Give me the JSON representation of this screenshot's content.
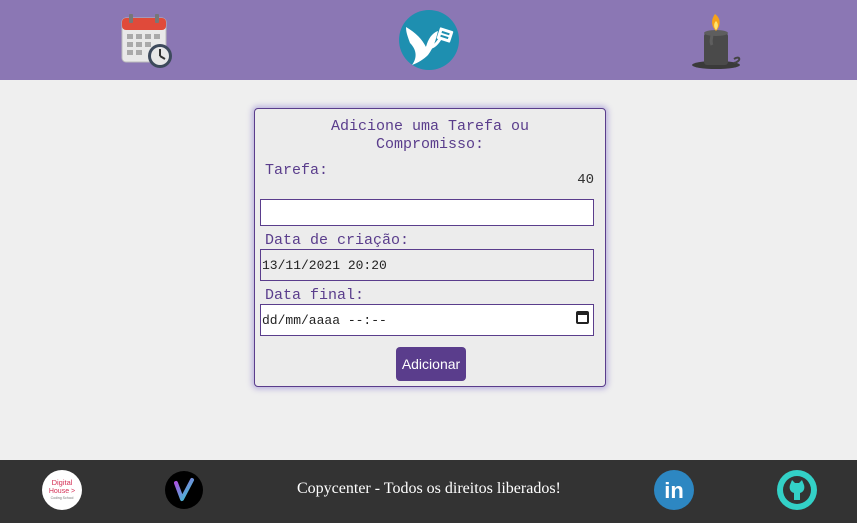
{
  "header": {
    "icons": [
      "calendar-clock-icon",
      "dove-logo-icon",
      "candle-icon"
    ],
    "accent": "#8b77b4"
  },
  "form": {
    "title_line1": "Adicione uma Tarefa ou",
    "title_line2": "Compromisso:",
    "task_label": "Tarefa:",
    "task_counter": "40",
    "task_value": "",
    "created_label": "Data de criação:",
    "created_value": "13/11/2021 20:20",
    "due_label": "Data final:",
    "due_placeholder": "dd/mm/aaaa --:--",
    "submit_label": "Adicionar",
    "accent": "#5a3d8c"
  },
  "footer": {
    "copyright": "Copycenter - Todos os direitos liberados!",
    "logos": [
      "digital-house-logo",
      "v-logo",
      "linkedin-icon",
      "github-icon"
    ],
    "dh_text_1": "Digital",
    "dh_text_2": "House >",
    "dh_text_3": "Coding School",
    "linkedin_text": "in"
  }
}
